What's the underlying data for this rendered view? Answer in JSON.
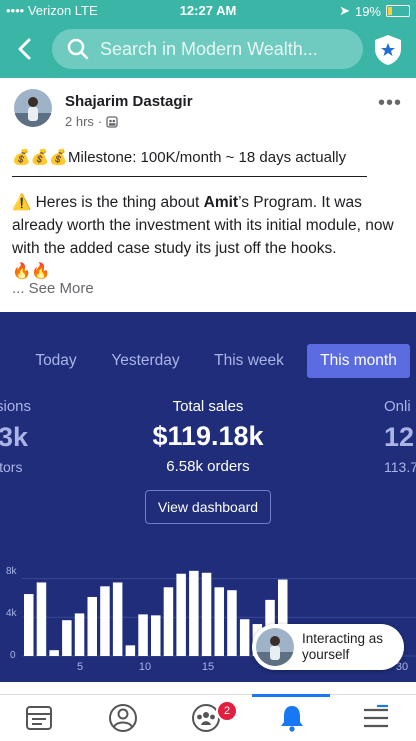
{
  "status_bar": {
    "carrier": "•••• Verizon  LTE",
    "time": "12:27 AM",
    "battery": "19%",
    "battery_level": 0.19
  },
  "header": {
    "search_text": "Search in Modern Wealth...",
    "accent": "#3ab5a6"
  },
  "post": {
    "author": "Shajarim Dastagir",
    "time": "2 hrs",
    "milestone": "💰💰💰Milestone: 100K/month ~ 18 days actually",
    "body_intro": "⚠️ Heres is the thing about ",
    "body_bold": "Amit",
    "body_rest": "’s Program. It was already worth the investment with its initial module, now with the added case study its just off the hooks.",
    "emojis": "🔥🔥",
    "see_more": "... See More"
  },
  "dashboard": {
    "tabs": [
      "Today",
      "Yesterday",
      "This week",
      "This month"
    ],
    "active_tab": 3,
    "left_partial": {
      "top": "sions",
      "value": "3k",
      "bottom": "itors"
    },
    "center": {
      "label": "Total sales",
      "value": "$119.18k",
      "sub": "6.58k orders"
    },
    "right_partial": {
      "top": "Onli",
      "value": "12",
      "bottom": "113.7"
    },
    "button": "View dashboard",
    "y_ticks": [
      "8k",
      "4k",
      "0"
    ],
    "x_ticks": [
      "5",
      "10",
      "15",
      "30"
    ]
  },
  "chart_data": {
    "type": "bar",
    "categories": [
      "1",
      "2",
      "3",
      "4",
      "5",
      "6",
      "7",
      "8",
      "9",
      "10",
      "11",
      "12",
      "13",
      "14",
      "15",
      "16",
      "17",
      "18",
      "19",
      "20",
      "21",
      "22"
    ],
    "values": [
      6.4,
      7.6,
      0.6,
      3.7,
      4.4,
      6.1,
      7.2,
      7.6,
      1.1,
      4.3,
      4.2,
      7.1,
      8.5,
      8.8,
      8.6,
      7.1,
      6.8,
      3.8,
      3.3,
      5.8,
      7.9,
      0
    ],
    "ylim": [
      0,
      9.3
    ],
    "ytick_values": [
      8,
      4,
      0
    ]
  },
  "toast": {
    "text_line1": "Interacting as",
    "text_line2": "yourself"
  },
  "bottom_nav": {
    "badge": "2"
  }
}
